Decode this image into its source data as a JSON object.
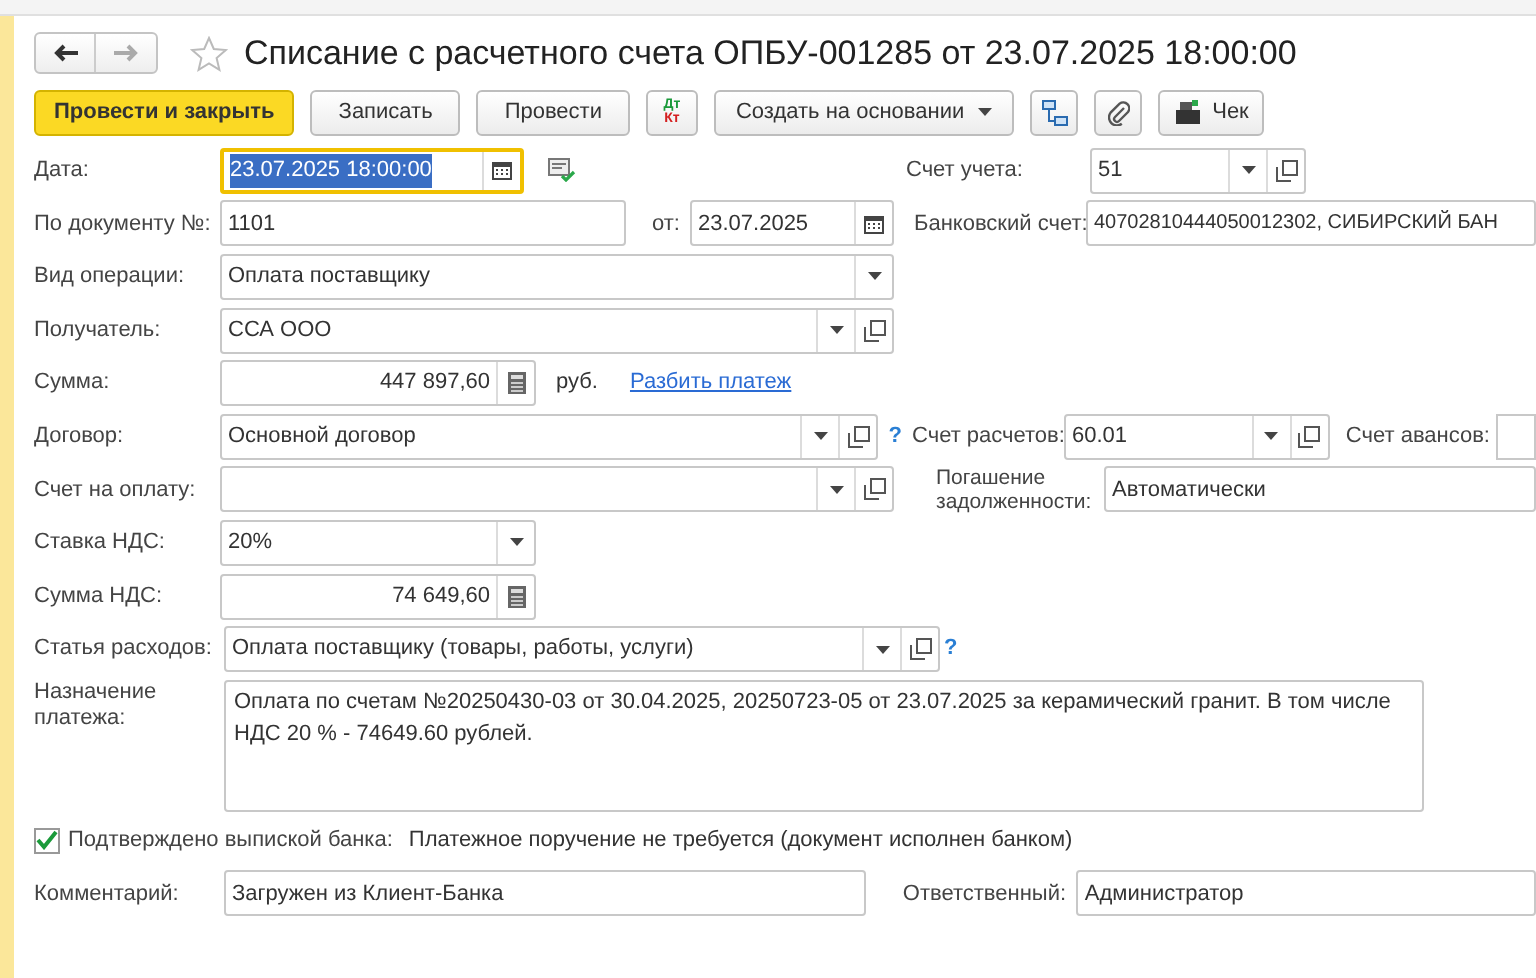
{
  "title": "Списание с расчетного счета ОПБУ-001285 от 23.07.2025 18:00:00",
  "toolbar": [
    {
      "kind": "primary",
      "label": "Провести и закрыть"
    },
    {
      "kind": "button",
      "label": "Записать"
    },
    {
      "kind": "button",
      "label": "Провести"
    },
    {
      "kind": "dtkt",
      "label": "Дт",
      "sublabel": "Кт"
    },
    {
      "kind": "menu",
      "label": "Создать на основании"
    },
    {
      "kind": "structure"
    },
    {
      "kind": "attach"
    },
    {
      "kind": "receipt",
      "label": "Чек"
    }
  ],
  "date": {
    "label": "Дата:",
    "value": "23.07.2025 18:00:00"
  },
  "account": {
    "label": "Счет учета:",
    "value": "51"
  },
  "doc_number": {
    "label": "По документу №:",
    "value": "1101",
    "from_label": "от:",
    "from_value": "23.07.2025"
  },
  "bank_account": {
    "label": "Банковский счет:",
    "value": "40702810444050012302, СИБИРСКИЙ БАН"
  },
  "operation": {
    "label": "Вид операции:",
    "value": "Оплата поставщику"
  },
  "recipient": {
    "label": "Получатель:",
    "value": "ССА ООО"
  },
  "amount": {
    "label": "Сумма:",
    "value": "447 897,60",
    "currency": "руб.",
    "link": "Разбить платеж"
  },
  "contract": {
    "label": "Договор:",
    "value": "Основной договор",
    "help": "?"
  },
  "settlement_account": {
    "label": "Счет расчетов:",
    "value": "60.01"
  },
  "advance_account": {
    "label": "Счет авансов:"
  },
  "invoice": {
    "label": "Счет на оплату:"
  },
  "repayment": {
    "label": "Погашение задолженности:",
    "value": "Автоматически"
  },
  "vat_rate": {
    "label": "Ставка НДС:",
    "value": "20%"
  },
  "vat_amount": {
    "label": "Сумма НДС:",
    "value": "74 649,60"
  },
  "expense_item": {
    "label": "Статья расходов:",
    "value": "Оплата поставщику (товары, работы, услуги)",
    "help": "?"
  },
  "purpose": {
    "label": "Назначение платежа:",
    "value": "Оплата по счетам №20250430-03 от 30.04.2025, 20250723-05 от 23.07.2025 за керамический гранит. В том числе НДС 20 % - 74649.60 рублей."
  },
  "confirmed": {
    "label": "Подтверждено выпиской банка:",
    "checked": true,
    "note": "Платежное поручение не требуется (документ исполнен банком)"
  },
  "comment": {
    "label": "Комментарий:",
    "value": "Загружен из Клиент-Банка"
  },
  "responsible": {
    "label": "Ответственный:",
    "value": "Администратор"
  }
}
